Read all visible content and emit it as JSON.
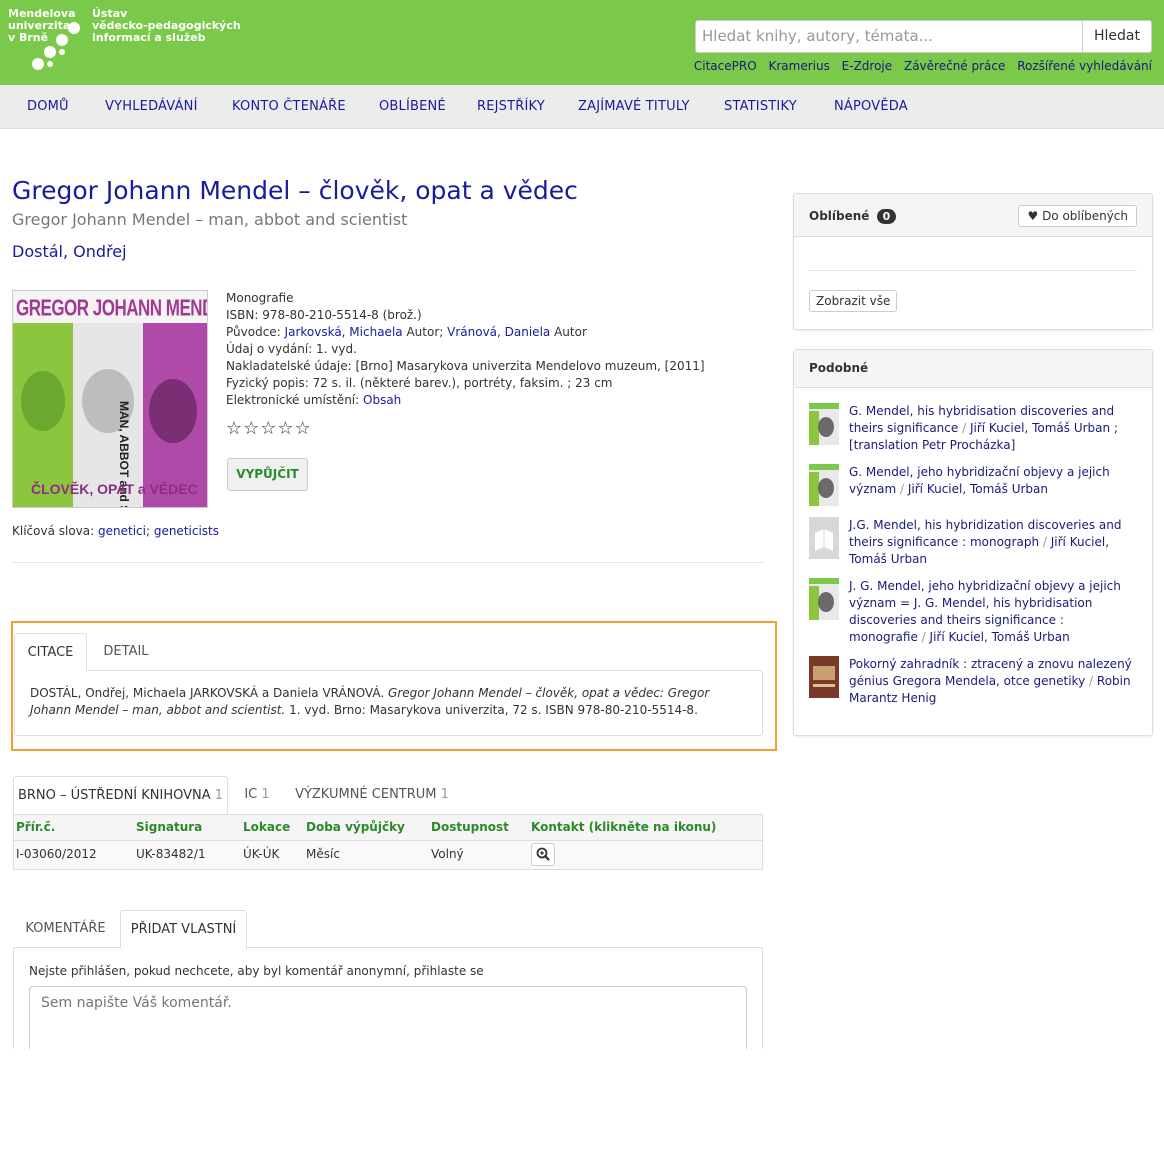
{
  "header": {
    "logo_left": [
      "Mendelova",
      "univerzita",
      "v Brně"
    ],
    "logo_right": [
      "Ústav",
      "vědecko-pedagogických",
      "informací a služeb"
    ],
    "search_placeholder": "Hledat knihy, autory, témata...",
    "search_button": "Hledat",
    "quick_links": [
      "CitacePRO",
      "Kramerius",
      "E-Zdroje",
      "Závěrečné práce",
      "Rozšířené vyhledávání"
    ]
  },
  "nav": [
    "DOMŮ",
    "VYHLEDÁVÁNÍ",
    "KONTO ČTENÁŘE",
    "OBLÍBENÉ",
    "REJSTŘÍKY",
    "ZAJÍMAVÉ TITULY",
    "STATISTIKY",
    "NÁPOVĚDA"
  ],
  "record": {
    "title": "Gregor Johann Mendel – člověk, opat a vědec",
    "subtitle": "Gregor Johann Mendel – man, abbot and scientist",
    "author": "Dostál, Ondřej",
    "cover_text": {
      "top": "GREGOR JOHANN MENDEL",
      "side": "MAN, ABBOT and SCIENTIST",
      "bottom": "ČLOVĚK, OPAT a VĚDEC"
    },
    "type": "Monografie",
    "isbn": "ISBN: 978-80-210-5514-8 (brož.)",
    "origin_label": "Původce:",
    "origin_author1": "Jarkovská, Michaela",
    "origin_role1": "Autor;",
    "origin_author2": "Vránová, Daniela",
    "origin_role2": "Autor",
    "edition": "Údaj o vydání: 1. vyd.",
    "publisher": "Nakladatelské údaje: [Brno] Masarykova univerzita Mendelovo muzeum, [2011]",
    "physical": "Fyzický popis: 72 s. il. (některé barev.), portréty, faksim. ; 23 cm",
    "electronic_label": "Elektronické umístění:",
    "electronic_link": "Obsah",
    "stars": "☆☆☆☆☆",
    "rating": 0,
    "borrow_button": "VYPŮJČIT",
    "keywords_label": "Klíčová slova:",
    "keyword1": "genetici",
    "keyword2": "geneticists"
  },
  "citation": {
    "tabs": [
      "CITACE",
      "DETAIL"
    ],
    "text_plain": "DOSTÁL, Ondřej, Michaela JARKOVSKÁ a Daniela VRÁNOVÁ.",
    "text_italic": "Gregor Johann Mendel – člověk, opat a vědec: Gregor Johann Mendel – man, abbot and scientist.",
    "text_rest": "1. vyd. Brno: Masarykova univerzita, 72 s. ISBN 978-80-210-5514-8."
  },
  "holdings": {
    "tabs": [
      {
        "label": "BRNO – ÚSTŘEDNÍ KNIHOVNA",
        "count": "1"
      },
      {
        "label": "IC",
        "count": "1"
      },
      {
        "label": "VÝZKUMNÉ CENTRUM",
        "count": "1"
      }
    ],
    "columns": [
      "Přír.č.",
      "Signatura",
      "Lokace",
      "Doba výpůjčky",
      "Dostupnost",
      "Kontakt (klikněte na ikonu)"
    ],
    "rows": [
      [
        "I-03060/2012",
        "UK-83482/1",
        "ÚK-ÚK",
        "Měsíc",
        "Volný"
      ]
    ]
  },
  "comments": {
    "tabs": [
      "KOMENTÁŘE",
      "PŘIDAT VLASTNÍ"
    ],
    "note": "Nejste přihlášen, pokud nechcete, aby byl komentář anonymní, přihlaste se",
    "placeholder": "Sem napište Váš komentář."
  },
  "favorites": {
    "title": "Oblíbené",
    "count": "0",
    "add_button": "Do oblíbených",
    "show_all": "Zobrazit vše"
  },
  "similar": {
    "title": "Podobné",
    "items": [
      {
        "title": "G. Mendel, his hybridisation discoveries and theirs significance",
        "authors": "Jiří Kuciel, Tomáš Urban ; [translation Petr Procházka]"
      },
      {
        "title": "G. Mendel, jeho hybridizační objevy a jejich význam",
        "authors": "Jiří Kuciel, Tomáš Urban"
      },
      {
        "title": "J.G. Mendel, his hybridization discoveries and theirs significance : monograph",
        "authors": "Jiří Kuciel, Tomáš Urban"
      },
      {
        "title": "J. G. Mendel, jeho hybridizační objevy a jejich význam = J. G. Mendel, his hybridisation discoveries and theirs significance : monografie",
        "authors": "Jiří Kuciel, Tomáš Urban"
      },
      {
        "title": "Pokorný zahradník : ztracený a znovu nalezený génius Gregora Mendela, otce genetiky",
        "authors": "Robin Marantz Henig"
      }
    ]
  },
  "colors": {
    "header_green": "#7ac94b",
    "link_blue": "#1a1a9c",
    "highlight_orange": "#f0a032",
    "table_head_green": "#2b8a2b"
  }
}
